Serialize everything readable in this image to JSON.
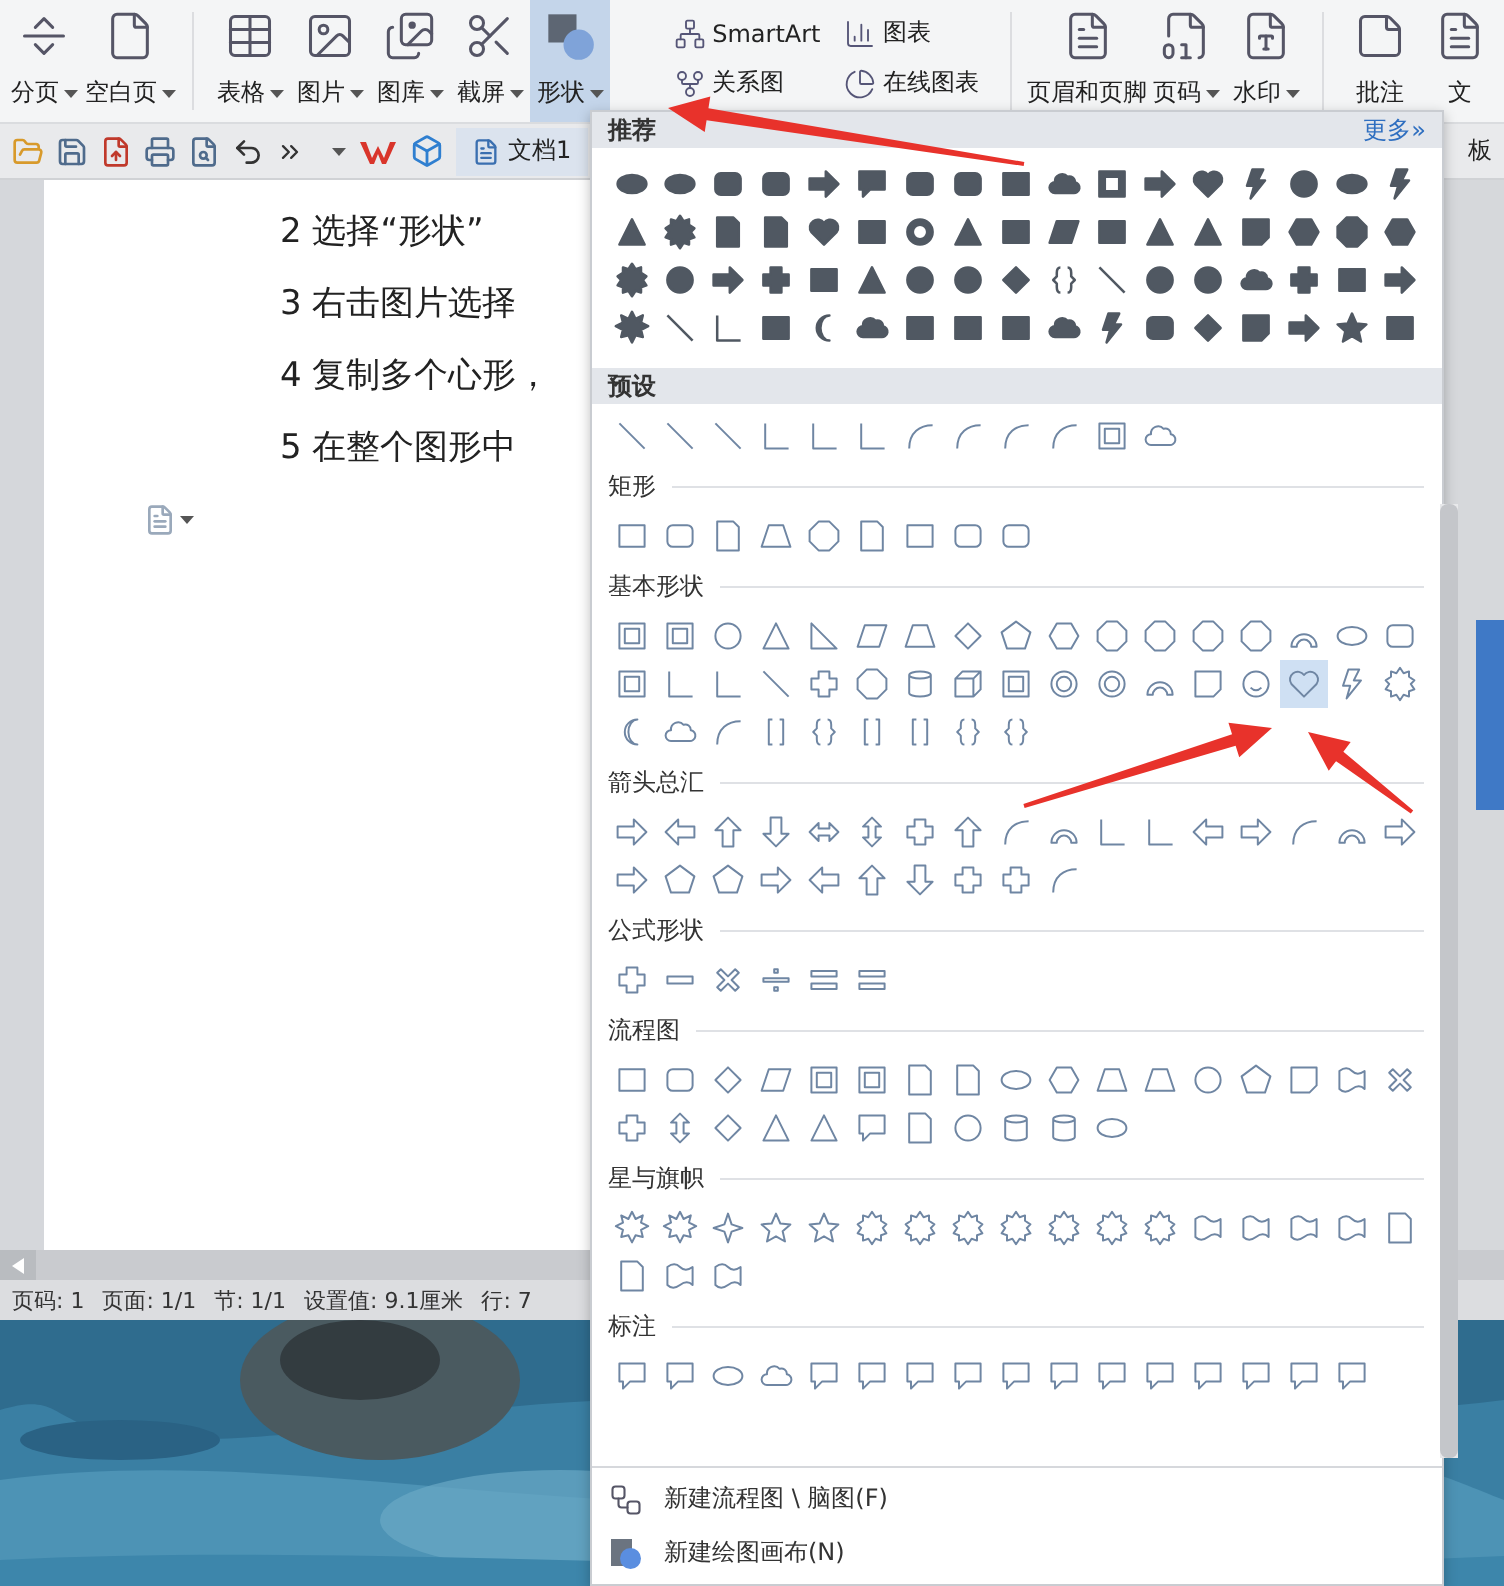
{
  "ribbon": {
    "left": [
      {
        "label": "分页",
        "dropdown": true,
        "selected": false
      },
      {
        "label": "空白页",
        "dropdown": true,
        "selected": false
      },
      {
        "label": "表格",
        "dropdown": true,
        "selected": false
      },
      {
        "label": "图片",
        "dropdown": true,
        "selected": false
      },
      {
        "label": "图库",
        "dropdown": true,
        "selected": false
      },
      {
        "label": "截屏",
        "dropdown": true,
        "selected": false
      },
      {
        "label": "形状",
        "dropdown": true,
        "selected": true
      }
    ],
    "small": [
      {
        "label": "SmartArt"
      },
      {
        "label": "图表"
      },
      {
        "label": "关系图"
      },
      {
        "label": "在线图表"
      }
    ],
    "right": [
      {
        "label": "页眉和页脚",
        "dropdown": false,
        "selected": false
      },
      {
        "label": "页码",
        "dropdown": true,
        "selected": false
      },
      {
        "label": "水印",
        "dropdown": true,
        "selected": false
      },
      {
        "label": "批注",
        "dropdown": false,
        "selected": false
      },
      {
        "label": "文",
        "dropdown": false,
        "selected": false
      }
    ]
  },
  "quick_bar": {
    "document_tab": "文档1",
    "side_label": "板"
  },
  "document": {
    "lines": [
      "2 选择“形状”",
      "3 右击图片选择",
      "4 复制多个心形，",
      "5 在整个图形中"
    ]
  },
  "status_bar": [
    "页码: 1",
    "页面: 1/1",
    "节: 1/1",
    "设置值: 9.1厘米",
    "行: 7"
  ],
  "shape_menu": {
    "recommended": {
      "title": "推荐",
      "more_link": "更多»",
      "rows": [
        [
          {
            "kind": "ellipse",
            "selected": false
          },
          {
            "kind": "ellipse",
            "selected": false
          },
          {
            "kind": "rounded-rectangle",
            "selected": false
          },
          {
            "kind": "rounded-rectangle",
            "selected": false
          },
          {
            "kind": "right-arrow",
            "selected": false
          },
          {
            "kind": "callout",
            "selected": false
          },
          {
            "kind": "rounded-rectangle",
            "selected": false
          },
          {
            "kind": "rounded-rectangle",
            "selected": false
          },
          {
            "kind": "rectangle",
            "selected": false
          },
          {
            "kind": "cloud",
            "selected": false
          },
          {
            "kind": "frame",
            "selected": false
          },
          {
            "kind": "right-arrow",
            "selected": false
          },
          {
            "kind": "heart",
            "selected": false
          },
          {
            "kind": "lightning",
            "selected": false
          },
          {
            "kind": "circle",
            "selected": false
          },
          {
            "kind": "ellipse",
            "selected": false
          },
          {
            "kind": "lightning",
            "selected": false
          }
        ],
        [
          {
            "kind": "triangle",
            "selected": false
          },
          {
            "kind": "seal",
            "selected": false
          },
          {
            "kind": "document",
            "selected": false
          },
          {
            "kind": "document",
            "selected": false
          },
          {
            "kind": "heart",
            "selected": false
          },
          {
            "kind": "rectangle",
            "selected": false
          },
          {
            "kind": "donut",
            "selected": false
          },
          {
            "kind": "triangle",
            "selected": false
          },
          {
            "kind": "rectangle",
            "selected": false
          },
          {
            "kind": "parallelogram",
            "selected": false
          },
          {
            "kind": "rectangle",
            "selected": false
          },
          {
            "kind": "triangle",
            "selected": false
          },
          {
            "kind": "triangle",
            "selected": false
          },
          {
            "kind": "note",
            "selected": false
          },
          {
            "kind": "hexagon",
            "selected": false
          },
          {
            "kind": "octagon",
            "selected": false
          },
          {
            "kind": "hexagon",
            "selected": false
          }
        ],
        [
          {
            "kind": "seal",
            "selected": false
          },
          {
            "kind": "circle",
            "selected": false
          },
          {
            "kind": "right-arrow",
            "selected": false
          },
          {
            "kind": "plus",
            "selected": false
          },
          {
            "kind": "rectangle",
            "selected": false
          },
          {
            "kind": "triangle",
            "selected": false
          },
          {
            "kind": "circle",
            "selected": false
          },
          {
            "kind": "circle",
            "selected": false
          },
          {
            "kind": "diamond",
            "selected": false
          },
          {
            "kind": "braces",
            "selected": false
          },
          {
            "kind": "line",
            "selected": false
          },
          {
            "kind": "circle",
            "selected": false
          },
          {
            "kind": "circle",
            "selected": false
          },
          {
            "kind": "cloud",
            "selected": false
          },
          {
            "kind": "plus",
            "selected": false
          },
          {
            "kind": "rectangle",
            "selected": false
          },
          {
            "kind": "right-arrow",
            "selected": false
          }
        ],
        [
          {
            "kind": "burst",
            "selected": false
          },
          {
            "kind": "line",
            "selected": false
          },
          {
            "kind": "elbow",
            "selected": false
          },
          {
            "kind": "rectangle",
            "selected": false
          },
          {
            "kind": "moon",
            "selected": false
          },
          {
            "kind": "cloud",
            "selected": false
          },
          {
            "kind": "rectangle",
            "selected": false
          },
          {
            "kind": "rectangle",
            "selected": false
          },
          {
            "kind": "rectangle",
            "selected": false
          },
          {
            "kind": "cloud",
            "selected": false
          },
          {
            "kind": "lightning",
            "selected": false
          },
          {
            "kind": "rounded-rectangle",
            "selected": false
          },
          {
            "kind": "diamond",
            "selected": false
          },
          {
            "kind": "note",
            "selected": false
          },
          {
            "kind": "right-arrow",
            "selected": false
          },
          {
            "kind": "star",
            "selected": false
          },
          {
            "kind": "rectangle",
            "selected": false
          }
        ]
      ]
    },
    "preset": {
      "title": "预设",
      "rows": [
        [
          {
            "kind": "line",
            "selected": false
          },
          {
            "kind": "line",
            "selected": false
          },
          {
            "kind": "line",
            "selected": false
          },
          {
            "kind": "elbow",
            "selected": false
          },
          {
            "kind": "elbow",
            "selected": false
          },
          {
            "kind": "elbow",
            "selected": false
          },
          {
            "kind": "curve",
            "selected": false
          },
          {
            "kind": "curve",
            "selected": false
          },
          {
            "kind": "curve",
            "selected": false
          },
          {
            "kind": "curve",
            "selected": false
          },
          {
            "kind": "frame",
            "selected": false
          },
          {
            "kind": "cloud",
            "selected": false
          }
        ]
      ]
    },
    "sections": [
      {
        "title": "矩形",
        "rows": [
          [
            {
              "kind": "rectangle",
              "selected": false
            },
            {
              "kind": "rounded-rectangle",
              "selected": false
            },
            {
              "kind": "document",
              "selected": false
            },
            {
              "kind": "trapezoid",
              "selected": false
            },
            {
              "kind": "octagon",
              "selected": false
            },
            {
              "kind": "document",
              "selected": false
            },
            {
              "kind": "rectangle",
              "selected": false
            },
            {
              "kind": "rounded-rectangle",
              "selected": false
            },
            {
              "kind": "rounded-rectangle",
              "selected": false
            }
          ]
        ]
      },
      {
        "title": "基本形状",
        "rows": [
          [
            {
              "kind": "frame",
              "selected": false
            },
            {
              "kind": "frame",
              "selected": false
            },
            {
              "kind": "circle",
              "selected": false
            },
            {
              "kind": "triangle",
              "selected": false
            },
            {
              "kind": "right-triangle",
              "selected": false
            },
            {
              "kind": "parallelogram",
              "selected": false
            },
            {
              "kind": "trapezoid",
              "selected": false
            },
            {
              "kind": "diamond",
              "selected": false
            },
            {
              "kind": "pentagon",
              "selected": false
            },
            {
              "kind": "hexagon",
              "selected": false
            },
            {
              "kind": "octagon",
              "selected": false
            },
            {
              "kind": "octagon",
              "selected": false
            },
            {
              "kind": "octagon",
              "selected": false
            },
            {
              "kind": "octagon",
              "selected": false
            },
            {
              "kind": "arc",
              "selected": false
            },
            {
              "kind": "ellipse",
              "selected": false
            },
            {
              "kind": "rounded-rectangle",
              "selected": false
            }
          ],
          [
            {
              "kind": "frame",
              "selected": false
            },
            {
              "kind": "elbow",
              "selected": false
            },
            {
              "kind": "elbow",
              "selected": false
            },
            {
              "kind": "line",
              "selected": false
            },
            {
              "kind": "plus",
              "selected": false
            },
            {
              "kind": "octagon",
              "selected": false
            },
            {
              "kind": "cylinder",
              "selected": false
            },
            {
              "kind": "cube",
              "selected": false
            },
            {
              "kind": "frame",
              "selected": false
            },
            {
              "kind": "donut",
              "selected": false
            },
            {
              "kind": "donut",
              "selected": false
            },
            {
              "kind": "arc",
              "selected": false
            },
            {
              "kind": "note",
              "selected": false
            },
            {
              "kind": "smiley",
              "selected": false
            },
            {
              "kind": "heart",
              "selected": true
            },
            {
              "kind": "lightning",
              "selected": false
            },
            {
              "kind": "seal",
              "selected": false
            }
          ],
          [
            {
              "kind": "moon",
              "selected": false
            },
            {
              "kind": "cloud",
              "selected": false
            },
            {
              "kind": "curve",
              "selected": false
            },
            {
              "kind": "brackets",
              "selected": false
            },
            {
              "kind": "braces",
              "selected": false
            },
            {
              "kind": "brackets",
              "selected": false
            },
            {
              "kind": "brackets",
              "selected": false
            },
            {
              "kind": "braces",
              "selected": false
            },
            {
              "kind": "braces",
              "selected": false
            }
          ]
        ]
      },
      {
        "title": "箭头总汇",
        "rows": [
          [
            {
              "kind": "right-arrow",
              "selected": false
            },
            {
              "kind": "left-arrow",
              "selected": false
            },
            {
              "kind": "up-arrow",
              "selected": false
            },
            {
              "kind": "down-arrow",
              "selected": false
            },
            {
              "kind": "left-right-arrow",
              "selected": false
            },
            {
              "kind": "up-down-arrow",
              "selected": false
            },
            {
              "kind": "plus",
              "selected": false
            },
            {
              "kind": "up-arrow",
              "selected": false
            },
            {
              "kind": "curve",
              "selected": false
            },
            {
              "kind": "arc",
              "selected": false
            },
            {
              "kind": "elbow",
              "selected": false
            },
            {
              "kind": "elbow",
              "selected": false
            },
            {
              "kind": "left-arrow",
              "selected": false
            },
            {
              "kind": "right-arrow",
              "selected": false
            },
            {
              "kind": "curve",
              "selected": false
            },
            {
              "kind": "arc",
              "selected": false
            },
            {
              "kind": "right-arrow",
              "selected": false
            }
          ],
          [
            {
              "kind": "right-arrow",
              "selected": false
            },
            {
              "kind": "pentagon",
              "selected": false
            },
            {
              "kind": "pentagon",
              "selected": false
            },
            {
              "kind": "right-arrow",
              "selected": false
            },
            {
              "kind": "left-arrow",
              "selected": false
            },
            {
              "kind": "up-arrow",
              "selected": false
            },
            {
              "kind": "down-arrow",
              "selected": false
            },
            {
              "kind": "plus",
              "selected": false
            },
            {
              "kind": "plus",
              "selected": false
            },
            {
              "kind": "curve",
              "selected": false
            }
          ]
        ]
      },
      {
        "title": "公式形状",
        "rows": [
          [
            {
              "kind": "plus",
              "selected": false
            },
            {
              "kind": "minus",
              "selected": false
            },
            {
              "kind": "multiply",
              "selected": false
            },
            {
              "kind": "divide",
              "selected": false
            },
            {
              "kind": "equal",
              "selected": false
            },
            {
              "kind": "equal",
              "selected": false
            }
          ]
        ]
      },
      {
        "title": "流程图",
        "rows": [
          [
            {
              "kind": "rectangle",
              "selected": false
            },
            {
              "kind": "rounded-rectangle",
              "selected": false
            },
            {
              "kind": "diamond",
              "selected": false
            },
            {
              "kind": "parallelogram",
              "selected": false
            },
            {
              "kind": "frame",
              "selected": false
            },
            {
              "kind": "frame",
              "selected": false
            },
            {
              "kind": "document",
              "selected": false
            },
            {
              "kind": "document",
              "selected": false
            },
            {
              "kind": "ellipse",
              "selected": false
            },
            {
              "kind": "hexagon",
              "selected": false
            },
            {
              "kind": "trapezoid",
              "selected": false
            },
            {
              "kind": "trapezoid",
              "selected": false
            },
            {
              "kind": "circle",
              "selected": false
            },
            {
              "kind": "pentagon",
              "selected": false
            },
            {
              "kind": "note",
              "selected": false
            },
            {
              "kind": "wave-flag",
              "selected": false
            },
            {
              "kind": "multiply",
              "selected": false
            }
          ],
          [
            {
              "kind": "plus",
              "selected": false
            },
            {
              "kind": "up-down-arrow",
              "selected": false
            },
            {
              "kind": "diamond",
              "selected": false
            },
            {
              "kind": "triangle",
              "selected": false
            },
            {
              "kind": "triangle",
              "selected": false
            },
            {
              "kind": "callout",
              "selected": false
            },
            {
              "kind": "document",
              "selected": false
            },
            {
              "kind": "circle",
              "selected": false
            },
            {
              "kind": "cylinder",
              "selected": false
            },
            {
              "kind": "cylinder",
              "selected": false
            },
            {
              "kind": "ellipse",
              "selected": false
            }
          ]
        ]
      },
      {
        "title": "星与旗帜",
        "rows": [
          [
            {
              "kind": "burst",
              "selected": false
            },
            {
              "kind": "burst",
              "selected": false
            },
            {
              "kind": "four-point-star",
              "selected": false
            },
            {
              "kind": "star",
              "selected": false
            },
            {
              "kind": "star",
              "selected": false
            },
            {
              "kind": "seal",
              "selected": false
            },
            {
              "kind": "seal",
              "selected": false
            },
            {
              "kind": "seal",
              "selected": false
            },
            {
              "kind": "seal",
              "selected": false
            },
            {
              "kind": "seal",
              "selected": false
            },
            {
              "kind": "seal",
              "selected": false
            },
            {
              "kind": "seal",
              "selected": false
            },
            {
              "kind": "wave-flag",
              "selected": false
            },
            {
              "kind": "wave-flag",
              "selected": false
            },
            {
              "kind": "wave-flag",
              "selected": false
            },
            {
              "kind": "wave-flag",
              "selected": false
            },
            {
              "kind": "document",
              "selected": false
            }
          ],
          [
            {
              "kind": "document",
              "selected": false
            },
            {
              "kind": "wave-flag",
              "selected": false
            },
            {
              "kind": "wave-flag",
              "selected": false
            }
          ]
        ]
      },
      {
        "title": "标注",
        "rows": [
          [
            {
              "kind": "callout",
              "selected": false
            },
            {
              "kind": "callout",
              "selected": false
            },
            {
              "kind": "ellipse",
              "selected": false
            },
            {
              "kind": "cloud",
              "selected": false
            },
            {
              "kind": "callout",
              "selected": false
            },
            {
              "kind": "callout",
              "selected": false
            },
            {
              "kind": "callout",
              "selected": false
            },
            {
              "kind": "callout",
              "selected": false
            },
            {
              "kind": "callout",
              "selected": false
            },
            {
              "kind": "callout",
              "selected": false
            },
            {
              "kind": "callout",
              "selected": false
            },
            {
              "kind": "callout",
              "selected": false
            },
            {
              "kind": "callout",
              "selected": false
            },
            {
              "kind": "callout",
              "selected": false
            },
            {
              "kind": "callout",
              "selected": false
            },
            {
              "kind": "callout",
              "selected": false
            }
          ]
        ]
      }
    ],
    "actions": [
      {
        "label": "新建流程图 \\ 脑图(F)"
      },
      {
        "label": "新建绘图画布(N)"
      }
    ]
  }
}
